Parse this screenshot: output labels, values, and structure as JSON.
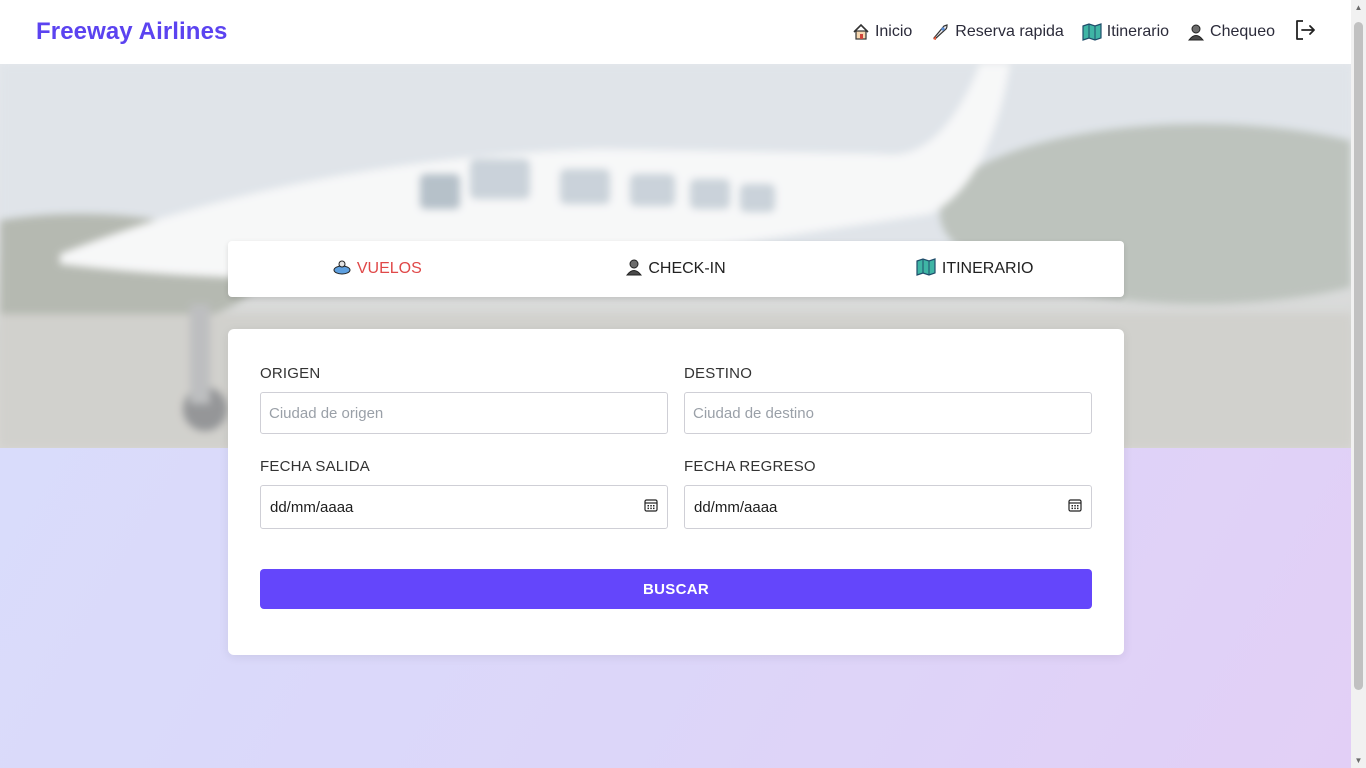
{
  "brand": "Freeway Airlines",
  "nav": {
    "items": [
      {
        "label": "Inicio",
        "icon": "home-icon"
      },
      {
        "label": "Reserva rapida",
        "icon": "rocket-icon"
      },
      {
        "label": "Itinerario",
        "icon": "map-icon"
      },
      {
        "label": "Chequeo",
        "icon": "person-icon"
      }
    ],
    "logout_icon": "logout-icon"
  },
  "tabs": [
    {
      "label": "VUELOS",
      "icon": "travel-icon",
      "active": true
    },
    {
      "label": "CHECK-IN",
      "icon": "person-icon",
      "active": false
    },
    {
      "label": "ITINERARIO",
      "icon": "map-icon",
      "active": false
    }
  ],
  "form": {
    "origin": {
      "label": "ORIGEN",
      "placeholder": "Ciudad de origen",
      "value": ""
    },
    "destination": {
      "label": "DESTINO",
      "placeholder": "Ciudad de destino",
      "value": ""
    },
    "departure": {
      "label": "FECHA SALIDA",
      "value": "dd/mm/aaaa"
    },
    "return": {
      "label": "FECHA REGRESO",
      "value": "dd/mm/aaaa"
    },
    "submit_label": "BUSCAR"
  },
  "colors": {
    "brand": "#5b43f0",
    "primary_button": "#6446fb",
    "active_tab": "#e04848"
  }
}
